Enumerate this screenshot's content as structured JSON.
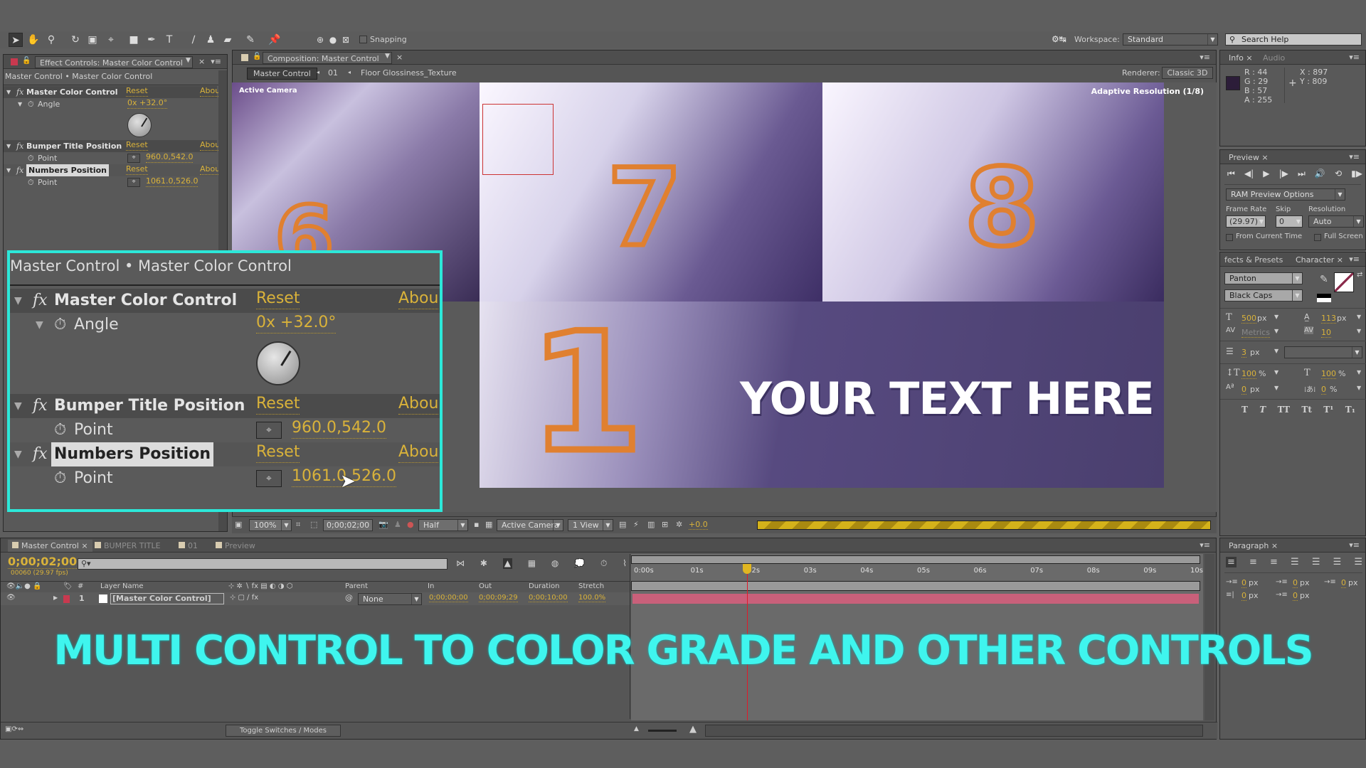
{
  "toolbar": {
    "tools": [
      "selection-tool",
      "hand-tool",
      "zoom-tool",
      "rotation-tool",
      "camera-tool",
      "pan-behind-tool",
      "rectangle-tool",
      "pen-tool",
      "type-tool",
      "brush-tool",
      "clone-stamp-tool",
      "eraser-tool",
      "roto-brush-tool",
      "puppet-pin-tool"
    ],
    "snapping_label": "Snapping",
    "workspace_label": "Workspace:",
    "workspace_value": "Standard",
    "search_placeholder": "Search Help"
  },
  "effect_controls": {
    "tab_label": "Effect Controls: Master Color Control",
    "breadcrumb": "Master Control • Master Color Control",
    "effects": [
      {
        "name": "Master Color Control",
        "reset": "Reset",
        "about": "Abou",
        "param": "Angle",
        "value": "0x +32.0°"
      },
      {
        "name": "Bumper Title Position",
        "reset": "Reset",
        "about": "Abou",
        "param": "Point",
        "value": "960.0,542.0"
      },
      {
        "name": "Numbers Position",
        "reset": "Reset",
        "about": "Abou",
        "param": "Point",
        "value": "1061.0,526.0"
      }
    ]
  },
  "composition": {
    "tab_label": "Composition: Master Control",
    "flow": [
      "Master Control",
      "01",
      "Floor Glossiness_Texture"
    ],
    "renderer_label": "Renderer:",
    "renderer_value": "Classic 3D",
    "active_camera_label": "Active Camera",
    "adaptive_label": "Adaptive Resolution (1/8)",
    "overlay_text": "YOUR TEXT HERE",
    "footer": {
      "zoom": "100%",
      "timecode": "0;00;02;00",
      "resolution": "Half",
      "view": "Active Camera",
      "layout": "1 View",
      "exposure": "+0.0"
    }
  },
  "info": {
    "tabs": [
      "Info",
      "Audio"
    ],
    "r": "R : 44",
    "g": "G : 29",
    "b": "B : 57",
    "a": "A : 255",
    "x": "X : 897",
    "y": "Y : 809",
    "swatch_color": "#2c1d39"
  },
  "preview": {
    "tab_label": "Preview",
    "ram_options": "RAM Preview Options",
    "frame_rate_label": "Frame Rate",
    "frame_rate": "(29.97)",
    "skip_label": "Skip",
    "skip": "0",
    "resolution_label": "Resolution",
    "resolution": "Auto",
    "from_current": "From Current Time",
    "full_screen": "Full Screen"
  },
  "character": {
    "tabs": [
      "fects & Presets",
      "Character"
    ],
    "font": "Panton",
    "style": "Black Caps",
    "size": "500",
    "size_unit": "px",
    "leading": "113",
    "leading_unit": "px",
    "kerning": "Metrics",
    "tracking": "10",
    "stroke": "3",
    "stroke_unit": "px",
    "vscale": "100",
    "vscale_unit": "%",
    "hscale": "100",
    "hscale_unit": "%",
    "baseline": "0",
    "baseline_unit": "px",
    "tsume": "0",
    "tsume_unit": "%",
    "styles": [
      "T",
      "T",
      "TT",
      "Tt",
      "T¹",
      "T₁"
    ]
  },
  "paragraph": {
    "tab_label": "Paragraph",
    "indents": [
      "0",
      "0",
      "0",
      "0",
      "0"
    ],
    "unit": "px"
  },
  "timeline": {
    "tabs": [
      "Master Control",
      "BUMPER TITLE",
      "01",
      "Preview"
    ],
    "timecode": "0;00;02;00",
    "frame_info": "00060 (29.97 fps)",
    "columns": [
      "#",
      "Layer Name",
      "Parent",
      "In",
      "Out",
      "Duration",
      "Stretch"
    ],
    "layers": [
      {
        "index": "1",
        "name": "[Master Color Control]",
        "parent": "None",
        "in": "0;00;00;00",
        "out": "0;00;09;29",
        "duration": "0;00;10;00",
        "stretch": "100.0%",
        "label_color": "#c8394f"
      }
    ],
    "ruler": [
      "0:00s",
      "01s",
      "02s",
      "03s",
      "04s",
      "05s",
      "06s",
      "07s",
      "08s",
      "09s",
      "10s"
    ],
    "playhead_seconds": 2,
    "duration_seconds": 10,
    "toggle_label": "Toggle Switches / Modes"
  },
  "caption": "MULTI CONTROL TO COLOR GRADE AND OTHER CONTROLS"
}
